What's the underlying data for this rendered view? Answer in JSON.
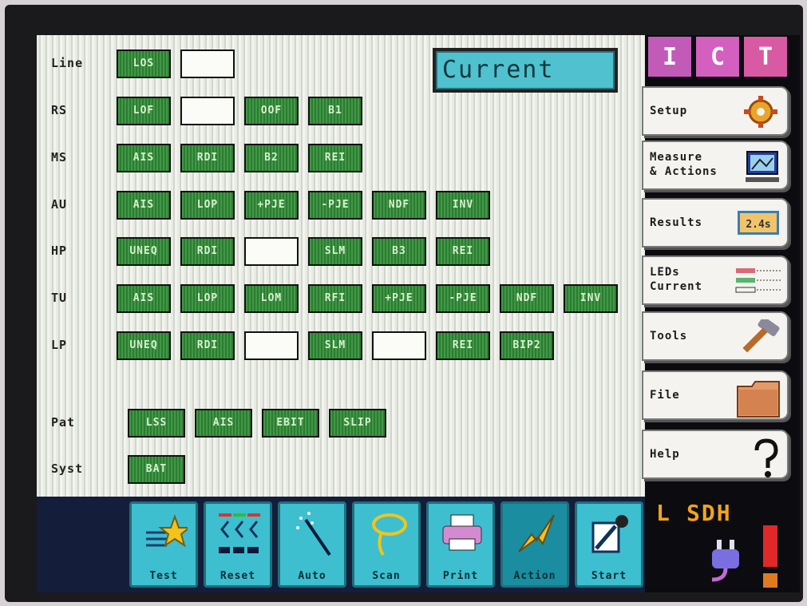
{
  "current_view": "Current",
  "rows": [
    {
      "label": "Line",
      "leds": [
        "LOS",
        ""
      ]
    },
    {
      "label": "RS",
      "leds": [
        "LOF",
        "",
        "OOF",
        "B1"
      ]
    },
    {
      "label": "MS",
      "leds": [
        "AIS",
        "RDI",
        "B2",
        "REI"
      ]
    },
    {
      "label": "AU",
      "leds": [
        "AIS",
        "LOP",
        "+PJE",
        "-PJE",
        "NDF",
        "INV"
      ]
    },
    {
      "label": "HP",
      "leds": [
        "UNEQ",
        "RDI",
        "",
        "SLM",
        "B3",
        "REI"
      ]
    },
    {
      "label": "TU",
      "leds": [
        "AIS",
        "LOP",
        "LOM",
        "RFI",
        "+PJE",
        "-PJE",
        "NDF",
        "INV"
      ]
    },
    {
      "label": "LP",
      "leds": [
        "UNEQ",
        "RDI",
        "",
        "SLM",
        "",
        "REI",
        "BIP2"
      ]
    },
    {
      "label": "Pat",
      "leds": [
        "LSS",
        "AIS",
        "EBIT",
        "SLIP"
      ]
    },
    {
      "label": "Syst",
      "leds": [
        "BAT"
      ]
    }
  ],
  "logo": {
    "letters": [
      "I",
      "C",
      "T"
    ],
    "colors": [
      "#c25bb8",
      "#d35fbf",
      "#d85aa3"
    ]
  },
  "menu": [
    {
      "id": "setup",
      "label": "Setup",
      "icon": "gear-icon"
    },
    {
      "id": "measure",
      "label": "Measure\n& Actions",
      "icon": "monitor-icon"
    },
    {
      "id": "results",
      "label": "Results",
      "icon": "results-badge",
      "badge": "2.4s"
    },
    {
      "id": "leds",
      "label": "LEDs\nCurrent",
      "icon": "leds-icon"
    },
    {
      "id": "tools",
      "label": "Tools",
      "icon": "hammer-icon"
    },
    {
      "id": "file",
      "label": "File",
      "icon": "folder-icon"
    },
    {
      "id": "help",
      "label": "Help",
      "icon": "question-icon"
    }
  ],
  "toolbar": [
    {
      "id": "test",
      "label": "Test",
      "icon": "star-icon"
    },
    {
      "id": "reset",
      "label": "Reset",
      "icon": "reset-icon"
    },
    {
      "id": "auto",
      "label": "Auto",
      "icon": "wand-icon"
    },
    {
      "id": "scan",
      "label": "Scan",
      "icon": "lasso-icon"
    },
    {
      "id": "print",
      "label": "Print",
      "icon": "printer-icon"
    },
    {
      "id": "action",
      "label": "Action",
      "icon": "lightning-icon"
    },
    {
      "id": "start",
      "label": "Start",
      "icon": "start-icon"
    }
  ],
  "status": {
    "mode": "L",
    "standard": "SDH"
  },
  "colors": {
    "led_green": "#3f9a44",
    "accent_cyan": "#3dbfd0",
    "status_orange": "#f2a41a"
  }
}
